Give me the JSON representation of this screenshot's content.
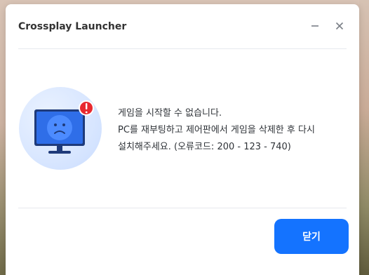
{
  "window": {
    "title": "Crossplay Launcher",
    "minimize_icon": "minimize-icon",
    "close_icon": "close-icon"
  },
  "error": {
    "lines": [
      "게임을 시작할 수 없습니다.",
      "PC를 재부팅하고 제어판에서 게임을 삭제한 후 다시",
      "설치해주세요. (오류코드: 200 - 123 - 740)"
    ],
    "illustration_icon": "monitor-sad-face-icon",
    "alert_badge_icon": "exclamation-badge-icon"
  },
  "actions": {
    "close_label": "닫기"
  },
  "colors": {
    "primary": "#1473ff",
    "badge": "#e8292f"
  }
}
